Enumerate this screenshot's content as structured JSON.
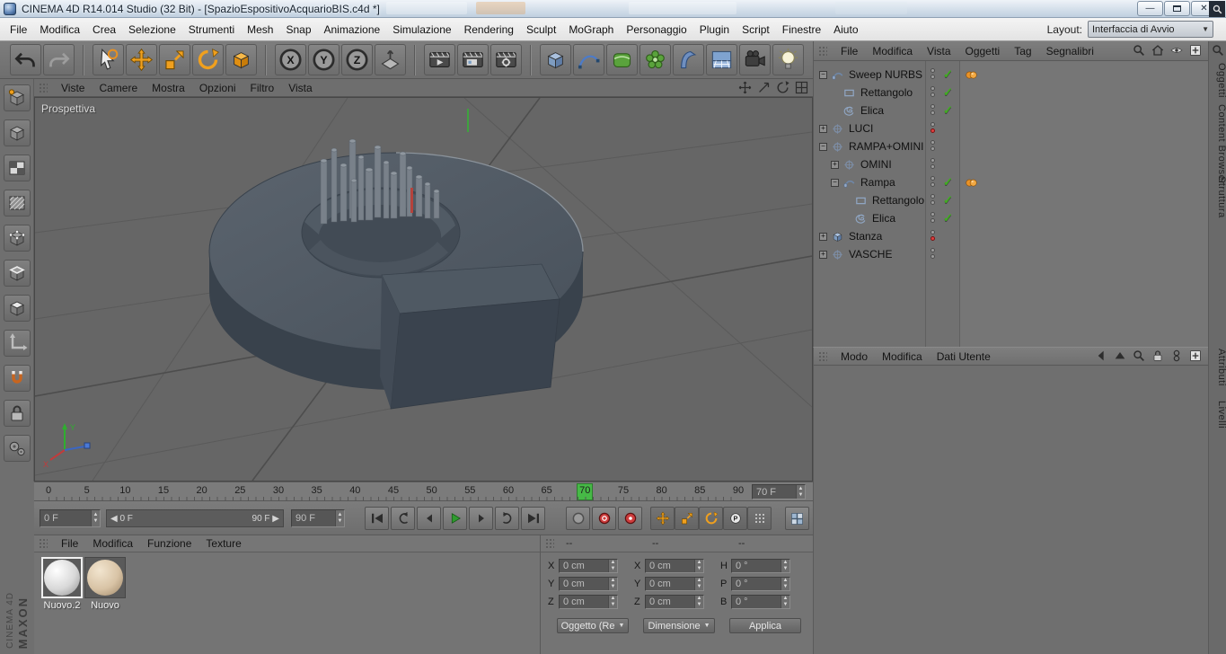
{
  "titlebar": {
    "title": "CINEMA 4D R14.014 Studio (32 Bit) - [SpazioEspositivoAcquarioBIS.c4d *]",
    "minimize_glyph": "—",
    "close_glyph": "✕"
  },
  "menubar": {
    "items": [
      "File",
      "Modifica",
      "Crea",
      "Selezione",
      "Strumenti",
      "Mesh",
      "Snap",
      "Animazione",
      "Simulazione",
      "Rendering",
      "Sculpt",
      "MoGraph",
      "Personaggio",
      "Plugin",
      "Script",
      "Finestre",
      "Aiuto"
    ],
    "layout_label": "Layout:",
    "layout_value": "Interfaccia di Avvio"
  },
  "toolbar": {
    "groups": [
      [
        "undo-icon",
        "redo-icon"
      ],
      [
        "live-selection-icon",
        "move-tool-icon",
        "scale-tool-icon",
        "rotate-tool-icon",
        "last-tool-icon"
      ],
      [
        "lock-x-icon",
        "lock-y-icon",
        "lock-z-icon",
        "coord-system-icon"
      ],
      [
        "render-view-icon",
        "render-picture-viewer-icon",
        "render-settings-icon"
      ],
      [
        "primitive-cube-icon",
        "spline-pen-icon",
        "nurbs-generator-icon",
        "modeling-generator-icon",
        "deformer-icon",
        "environment-icon",
        "camera-icon",
        "light-icon"
      ]
    ],
    "axis_labels": {
      "lock-x-icon": "X",
      "lock-y-icon": "Y",
      "lock-z-icon": "Z"
    }
  },
  "left_toolbar": {
    "icons": [
      "make-editable-icon",
      "model-mode-icon",
      "texture-mode-icon",
      "workplane-mode-icon",
      "points-mode-icon",
      "edges-mode-icon",
      "polygons-mode-icon",
      "axis-mode-icon",
      "snap-icon",
      "lock-workplane-icon",
      "viewport-filter-icon"
    ]
  },
  "viewport": {
    "menu_items": [
      "Viste",
      "Camere",
      "Mostra",
      "Opzioni",
      "Filtro",
      "Vista"
    ],
    "view_label": "Prospettiva",
    "nav_icons": [
      "pan-view-icon",
      "dolly-view-icon",
      "rotate-view-icon",
      "toggle-views-icon"
    ]
  },
  "timeline": {
    "tick_labels": [
      0,
      5,
      10,
      15,
      20,
      25,
      30,
      35,
      40,
      45,
      50,
      55,
      60,
      65,
      70,
      75,
      80,
      85,
      90
    ],
    "current_frame": 70,
    "current_frame_field": "70 F"
  },
  "transport": {
    "start_frame_field": "0 F",
    "range_start_label": "0 F",
    "range_end_label": "90 F",
    "end_frame_field": "90 F",
    "buttons": [
      "goto-start-icon",
      "play-backwards-icon",
      "prev-frame-icon",
      "play-icon",
      "next-frame-icon",
      "loop-icon",
      "goto-end-icon"
    ],
    "record_buttons": [
      "record-gray-icon",
      "record-objects-icon",
      "autokey-icon"
    ],
    "key_toggles": [
      "key-position-icon",
      "key-scale-icon",
      "key-rotation-icon",
      "key-parameter-icon",
      "key-pla-icon"
    ],
    "extra_button": "keyframe-selection-icon"
  },
  "materials": {
    "menu_items": [
      "File",
      "Modifica",
      "Funzione",
      "Texture"
    ],
    "items": [
      {
        "name": "Nuovo.2",
        "selected": true,
        "sphere": "white"
      },
      {
        "name": "Nuovo",
        "selected": false,
        "sphere": "tan"
      }
    ]
  },
  "coordinates": {
    "section_headers": [
      "--",
      "--",
      "--"
    ],
    "rows": [
      {
        "pos_label": "X",
        "pos_value": "0 cm",
        "size_label": "X",
        "size_value": "0 cm",
        "rot_label": "H",
        "rot_value": "0 °"
      },
      {
        "pos_label": "Y",
        "pos_value": "0 cm",
        "size_label": "Y",
        "size_value": "0 cm",
        "rot_label": "P",
        "rot_value": "0 °"
      },
      {
        "pos_label": "Z",
        "pos_value": "0 cm",
        "size_label": "Z",
        "size_value": "0 cm",
        "rot_label": "B",
        "rot_value": "0 °"
      }
    ],
    "buttons": [
      {
        "label": "Oggetto (Re",
        "dropdown": true
      },
      {
        "label": "Dimensione",
        "dropdown": true
      },
      {
        "label": "Applica",
        "dropdown": false
      }
    ]
  },
  "object_manager": {
    "menu_items": [
      "File",
      "Modifica",
      "Vista",
      "Oggetti",
      "Tag",
      "Segnalibri"
    ],
    "corner_icons": [
      "search-icon",
      "home-icon",
      "eye-icon",
      "add-panel-icon"
    ],
    "tree": [
      {
        "label": "Sweep NURBS",
        "level": 0,
        "toggle": "-",
        "icon": "sweep-nurbs-icon",
        "state": "check",
        "tag": true
      },
      {
        "label": "Rettangolo",
        "level": 1,
        "toggle": "",
        "icon": "rectangle-spline-icon",
        "state": "check",
        "tag": false
      },
      {
        "label": "Elica",
        "level": 1,
        "toggle": "",
        "icon": "helix-spline-icon",
        "state": "check",
        "tag": false
      },
      {
        "label": "LUCI",
        "level": 0,
        "toggle": "+",
        "icon": "null-object-icon",
        "state": "red",
        "tag": false
      },
      {
        "label": "RAMPA+OMINI",
        "level": 0,
        "toggle": "-",
        "icon": "null-object-icon",
        "state": "plain",
        "tag": false
      },
      {
        "label": "OMINI",
        "level": 1,
        "toggle": "+",
        "icon": "null-object-icon",
        "state": "plain",
        "tag": false
      },
      {
        "label": "Rampa",
        "level": 1,
        "toggle": "-",
        "icon": "sweep-nurbs-icon",
        "state": "check",
        "tag": true
      },
      {
        "label": "Rettangolo",
        "level": 2,
        "toggle": "",
        "icon": "rectangle-spline-icon",
        "state": "check",
        "tag": false
      },
      {
        "label": "Elica",
        "level": 2,
        "toggle": "",
        "icon": "helix-spline-icon",
        "state": "check",
        "tag": false
      },
      {
        "label": "Stanza",
        "level": 0,
        "toggle": "+",
        "icon": "cube-object-icon",
        "state": "red",
        "tag": false
      },
      {
        "label": "VASCHE",
        "level": 0,
        "toggle": "+",
        "icon": "null-object-icon",
        "state": "plain",
        "tag": false
      }
    ]
  },
  "attribute_manager": {
    "menu_items": [
      "Modo",
      "Modifica",
      "Dati Utente"
    ],
    "corner_icons": [
      "back-icon",
      "up-icon",
      "search-icon",
      "lock-icon",
      "keyframe-icon",
      "add-panel-icon"
    ]
  },
  "side_tabs": {
    "top": [
      "Oggetti",
      "Content Browser",
      "Struttura"
    ],
    "bottom": [
      "Attributi",
      "Livelli"
    ]
  },
  "brand": {
    "maxon": "MAXON",
    "cinema": "CINEMA 4D"
  }
}
